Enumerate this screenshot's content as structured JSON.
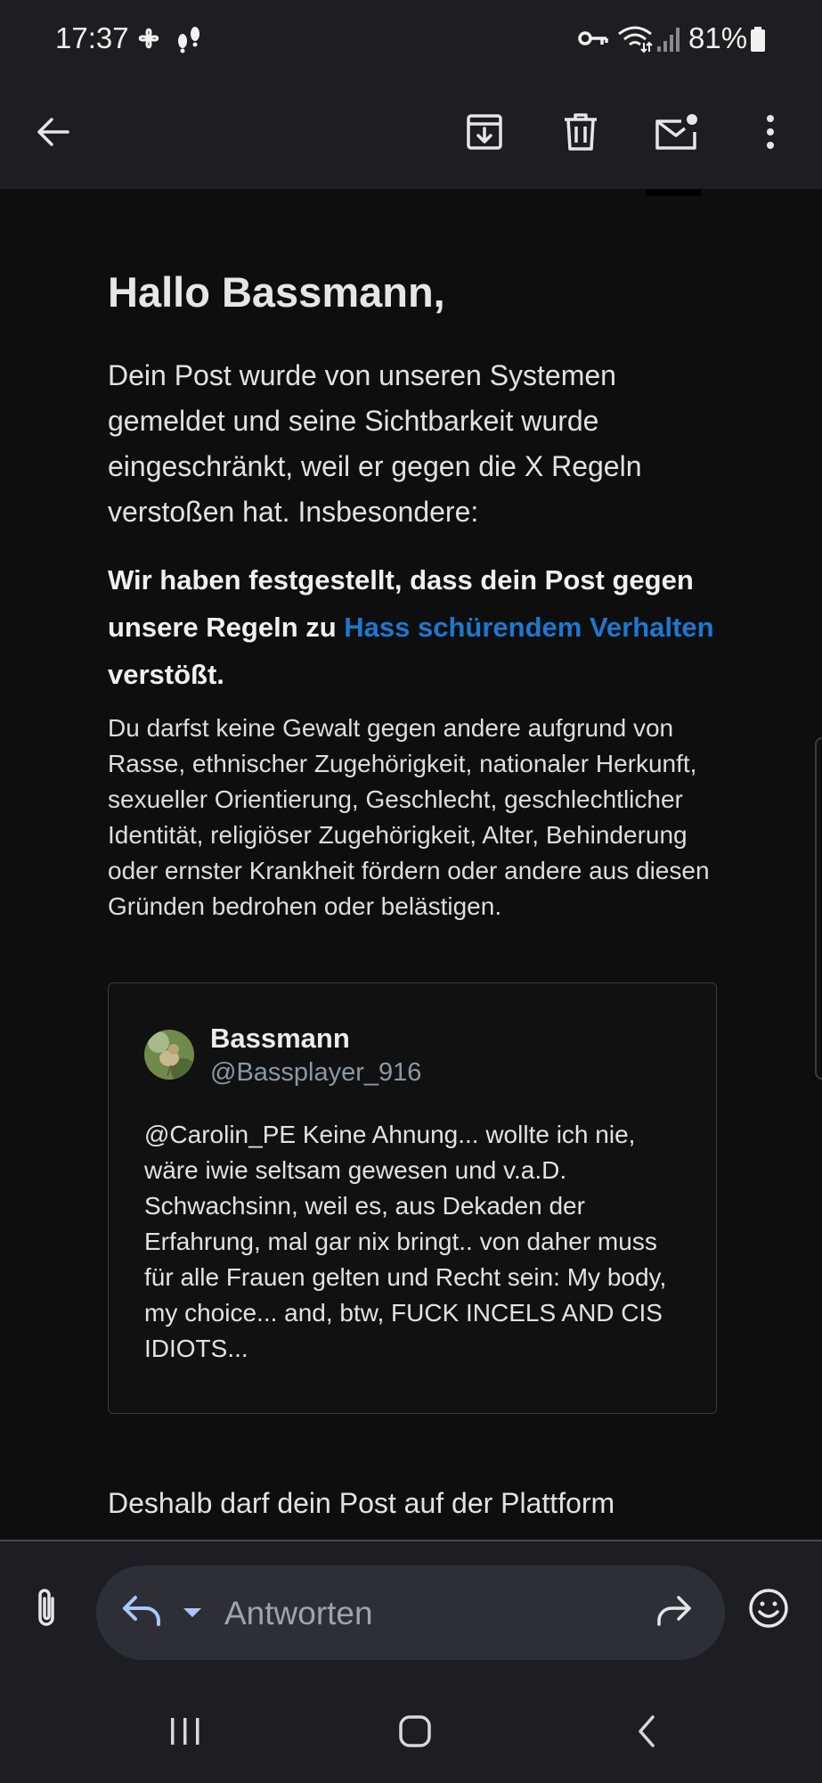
{
  "status_bar": {
    "time": "17:37",
    "battery": "81%",
    "left_icons": [
      "pinwheel-icon",
      "notification-icon"
    ],
    "right_icons": [
      "vpn-key-icon",
      "wifi-icon",
      "signal-icon",
      "battery-icon"
    ]
  },
  "toolbar": {
    "back_icon": "arrow-left-icon",
    "archive_icon": "archive-icon",
    "delete_icon": "trash-icon",
    "mark_unread_icon": "mail-unread-icon",
    "more_icon": "more-vert-icon"
  },
  "email": {
    "greeting": "Hallo Bassmann,",
    "intro": "Dein Post wurde von unseren Systemen gemeldet und seine Sichtbarkeit wurde eingeschränkt, weil er gegen die X Regeln verstoßen hat. Insbesondere:",
    "violation_prefix": "Wir haben festgestellt, dass dein Post gegen unsere Regeln zu ",
    "violation_link": "Hass schürendem Verhalten",
    "violation_suffix": " verstößt.",
    "description": "Du darfst keine Gewalt gegen andere aufgrund von Rasse, ethnischer Zugehörigkeit, nationaler Herkunft, sexueller Orientierung, Geschlecht, geschlechtlicher Identität, religiöser Zugehörigkeit, Alter, Behinderung oder ernster Krankheit fördern oder andere aus diesen Gründen bedrohen oder belästigen.",
    "tweet": {
      "name": "Bassmann",
      "handle": "@Bassplayer_916",
      "text": "@Carolin_PE Keine Ahnung... wollte ich nie, wäre iwie seltsam gewesen und v.a.D. Schwachsinn, weil es, aus Dekaden der Erfahrung, mal gar nix bringt.. von daher muss für alle Frauen gelten und Recht sein: My body, my choice... and, btw, FUCK INCELS AND CIS IDIOTS..."
    },
    "trailing_text": "Deshalb darf dein Post auf der Plattform"
  },
  "reply_bar": {
    "placeholder": "Antworten",
    "attach_icon": "paperclip-icon",
    "reply_icon": "reply-icon",
    "forward_icon": "forward-icon",
    "emoji_icon": "emoji-icon"
  },
  "nav_bar": {
    "recents_icon": "recents-icon",
    "home_icon": "home-icon",
    "back_icon": "nav-back-icon"
  },
  "colors": {
    "background": "#0e0e0e",
    "bar": "#1d1d22",
    "link": "#1d78d0",
    "handle": "#8b98a5"
  }
}
